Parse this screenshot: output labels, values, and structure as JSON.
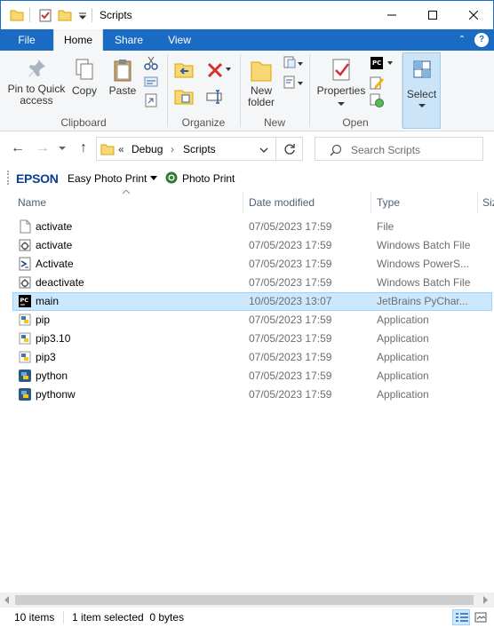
{
  "window": {
    "title": "Scripts"
  },
  "ribbon_tabs": [
    {
      "label": "File"
    },
    {
      "label": "Home"
    },
    {
      "label": "Share"
    },
    {
      "label": "View"
    }
  ],
  "ribbon": {
    "clipboard": {
      "group_label": "Clipboard",
      "pin_label_1": "Pin to Quick",
      "pin_label_2": "access",
      "copy_label": "Copy",
      "paste_label": "Paste"
    },
    "organize": {
      "group_label": "Organize"
    },
    "new": {
      "group_label": "New",
      "new_folder_1": "New",
      "new_folder_2": "folder"
    },
    "open": {
      "group_label": "Open",
      "properties_label": "Properties"
    },
    "select": {
      "select_label": "Select"
    }
  },
  "address": {
    "prefix": "«",
    "crumbs": [
      "Debug",
      "Scripts"
    ],
    "search_placeholder": "Search Scripts"
  },
  "epson": {
    "logo": "EPSON",
    "menu_label": "Easy Photo Print",
    "photo_print_label": "Photo Print"
  },
  "columns": {
    "name": "Name",
    "date": "Date modified",
    "type": "Type",
    "size": "Siz"
  },
  "files": [
    {
      "name": "activate",
      "date": "07/05/2023 17:59",
      "type": "File",
      "icon": "blank-file-icon"
    },
    {
      "name": "activate",
      "date": "07/05/2023 17:59",
      "type": "Windows Batch File",
      "icon": "batch-file-icon"
    },
    {
      "name": "Activate",
      "date": "07/05/2023 17:59",
      "type": "Windows PowerS...",
      "icon": "powershell-icon"
    },
    {
      "name": "deactivate",
      "date": "07/05/2023 17:59",
      "type": "Windows Batch File",
      "icon": "batch-file-icon"
    },
    {
      "name": "main",
      "date": "10/05/2023 13:07",
      "type": "JetBrains PyChar...",
      "icon": "pycharm-icon",
      "selected": true
    },
    {
      "name": "pip",
      "date": "07/05/2023 17:59",
      "type": "Application",
      "icon": "python-app-icon"
    },
    {
      "name": "pip3.10",
      "date": "07/05/2023 17:59",
      "type": "Application",
      "icon": "python-app-icon"
    },
    {
      "name": "pip3",
      "date": "07/05/2023 17:59",
      "type": "Application",
      "icon": "python-app-icon"
    },
    {
      "name": "python",
      "date": "07/05/2023 17:59",
      "type": "Application",
      "icon": "python-icon"
    },
    {
      "name": "pythonw",
      "date": "07/05/2023 17:59",
      "type": "Application",
      "icon": "python-icon"
    }
  ],
  "status": {
    "items": "10 items",
    "selection": "1 item selected  0 bytes"
  },
  "colors": {
    "accent": "#1a6bc4",
    "selection": "#cce8ff"
  }
}
